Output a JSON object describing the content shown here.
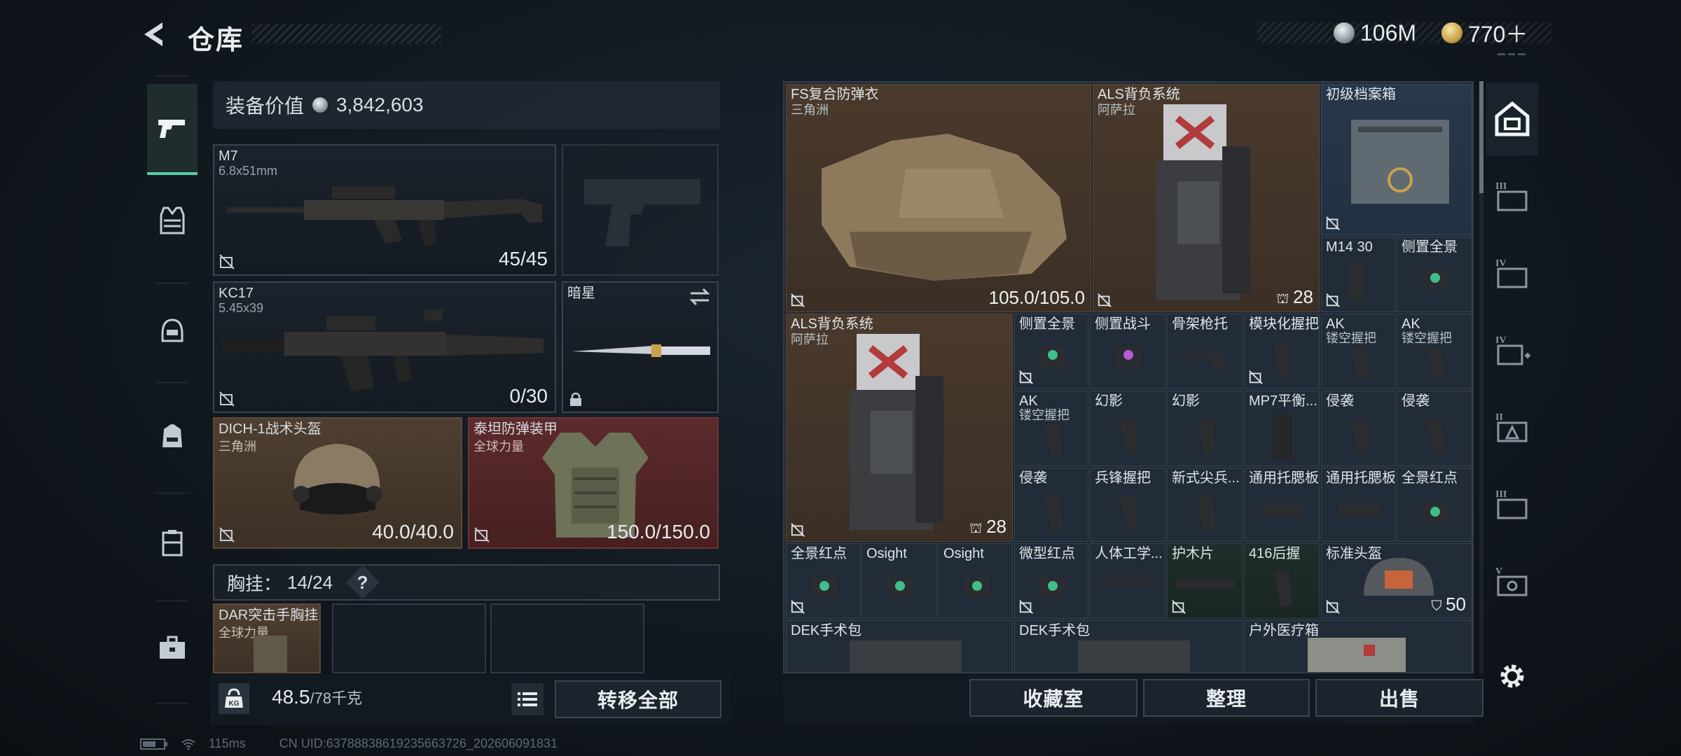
{
  "header": {
    "title": "仓库",
    "back_icon": "back-arrow-icon"
  },
  "currency": [
    {
      "icon": "silver-coin-icon",
      "value": "106M"
    },
    {
      "icon": "gold-coin-icon",
      "value": "770＋"
    }
  ],
  "sidebar": {
    "items": [
      {
        "icon": "pistol-icon",
        "active": true
      },
      {
        "icon": "vest-icon",
        "active": false
      },
      {
        "icon": "helmet-icon",
        "active": false
      },
      {
        "icon": "backpack-icon",
        "active": false
      },
      {
        "icon": "case-icon",
        "active": false
      },
      {
        "icon": "toolbox-icon",
        "active": false
      }
    ]
  },
  "loadout": {
    "value_label": "装备价值",
    "value": "3,842,603",
    "primary": {
      "name": "M7",
      "caliber": "6.8x51mm",
      "ammo": "45/45"
    },
    "secondary": {
      "name": "KC17",
      "caliber": "5.45x39",
      "ammo": "0/30"
    },
    "melee": {
      "name": "暗星"
    },
    "helmet": {
      "name": "DICH-1战术头盔",
      "source": "三角洲",
      "durability": "40.0/40.0"
    },
    "armor": {
      "name": "泰坦防弹装甲",
      "source": "全球力量",
      "durability": "150.0/150.0"
    },
    "chest_label": "胸挂：",
    "chest_capacity": "14/24",
    "help": "?",
    "chest_rig": {
      "name": "DAR突击手胸挂",
      "source": "全球力量"
    }
  },
  "footer": {
    "weight_current": "48.5",
    "weight_max": "/78千克",
    "kg_icon_text": "KG",
    "transfer_all": "转移全部",
    "vault": "收藏室",
    "organize": "整理",
    "sell": "出售"
  },
  "storage": {
    "items": [
      {
        "id": "fs-armor",
        "name": "FS复合防弹衣",
        "sub": "三角洲",
        "value": "105.0/105.0"
      },
      {
        "id": "als-pack-1",
        "name": "ALS背负系统",
        "sub": "阿萨拉",
        "value": "28"
      },
      {
        "id": "archive-box",
        "name": "初级档案箱"
      },
      {
        "id": "m14-mag",
        "name": "M14 30"
      },
      {
        "id": "side-scope-1",
        "name": "侧置全景"
      },
      {
        "id": "als-pack-2",
        "name": "ALS背负系统",
        "sub": "阿萨拉",
        "value": "28"
      },
      {
        "id": "side-scope-2",
        "name": "侧置全景"
      },
      {
        "id": "side-combat",
        "name": "侧置战斗"
      },
      {
        "id": "skeleton-stock",
        "name": "骨架枪托"
      },
      {
        "id": "modular-grip",
        "name": "模块化握把"
      },
      {
        "id": "ak-grip-1",
        "name": "AK",
        "sub": "镂空握把"
      },
      {
        "id": "ak-grip-2",
        "name": "AK",
        "sub": "镂空握把"
      },
      {
        "id": "ak-grip-3",
        "name": "AK",
        "sub": "镂空握把"
      },
      {
        "id": "phantom-1",
        "name": "幻影"
      },
      {
        "id": "phantom-2",
        "name": "幻影"
      },
      {
        "id": "mp7-grip",
        "name": "MP7平衡..."
      },
      {
        "id": "raid-1",
        "name": "侵袭"
      },
      {
        "id": "raid-2",
        "name": "侵袭"
      },
      {
        "id": "raid-3",
        "name": "侵袭"
      },
      {
        "id": "vanguard-grip",
        "name": "兵锋握把"
      },
      {
        "id": "new-tip",
        "name": "新式尖兵..."
      },
      {
        "id": "cheek-1",
        "name": "通用托腮板"
      },
      {
        "id": "cheek-2",
        "name": "通用托腮板"
      },
      {
        "id": "reddot-1",
        "name": "全景红点"
      },
      {
        "id": "reddot-2",
        "name": "全景红点"
      },
      {
        "id": "osight-1",
        "name": "Osight"
      },
      {
        "id": "osight-2",
        "name": "Osight"
      },
      {
        "id": "micro-reddot",
        "name": "微型红点"
      },
      {
        "id": "ergo",
        "name": "人体工学..."
      },
      {
        "id": "wood-guard",
        "name": "护木片"
      },
      {
        "id": "grip-416",
        "name": "416后握"
      },
      {
        "id": "std-helmet",
        "name": "标准头盔",
        "value": "50"
      },
      {
        "id": "dek-1",
        "name": "DEK手术包"
      },
      {
        "id": "dek-2",
        "name": "DEK手术包"
      },
      {
        "id": "outdoor-med",
        "name": "户外医疗箱"
      }
    ]
  },
  "rail": {
    "items": [
      {
        "icon": "storage-icon",
        "active": true
      },
      {
        "icon": "storage-tier-3-icon"
      },
      {
        "icon": "storage-tier-4-icon"
      },
      {
        "icon": "storage-tier-4-plus-icon"
      },
      {
        "icon": "storage-tier-2-icon"
      },
      {
        "icon": "storage-tier-3-b-icon"
      },
      {
        "icon": "storage-tier-5-icon"
      },
      {
        "icon": "settings-gear-icon"
      }
    ]
  },
  "status": {
    "ping": "115ms",
    "uid": "CN UID:637888386192356637​26_202606091831"
  }
}
